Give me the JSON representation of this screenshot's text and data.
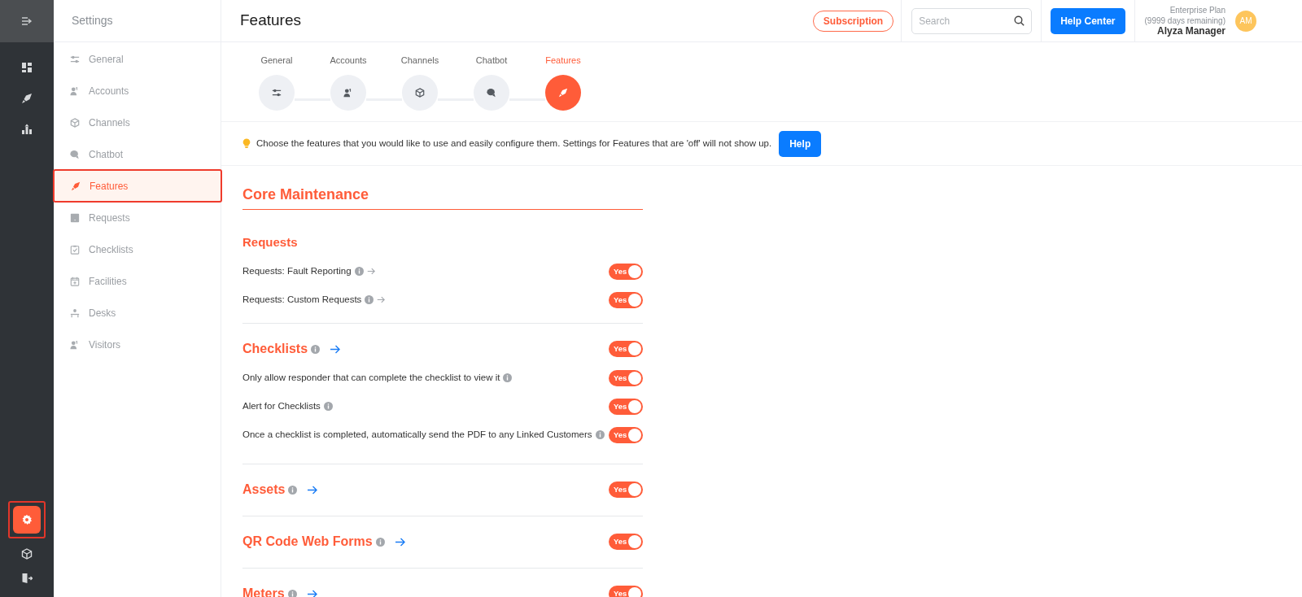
{
  "rail": {
    "top_items": [
      {
        "selected": false
      },
      {
        "selected": false
      },
      {
        "selected": false
      }
    ],
    "bottom_items": [
      {
        "selected": true
      },
      {
        "selected": false
      },
      {
        "selected": false
      }
    ]
  },
  "sidebar": {
    "title": "Settings",
    "items": [
      {
        "label": "General",
        "selected": false
      },
      {
        "label": "Accounts",
        "selected": false
      },
      {
        "label": "Channels",
        "selected": false
      },
      {
        "label": "Chatbot",
        "selected": false
      },
      {
        "label": "Features",
        "selected": true
      },
      {
        "label": "Requests",
        "selected": false
      },
      {
        "label": "Checklists",
        "selected": false
      },
      {
        "label": "Facilities",
        "selected": false
      },
      {
        "label": "Desks",
        "selected": false
      },
      {
        "label": "Visitors",
        "selected": false
      }
    ]
  },
  "header": {
    "title": "Features",
    "subscription": "Subscription",
    "search": {
      "placeholder": "Search"
    },
    "help_center": "Help Center",
    "plan": "Enterprise Plan",
    "days": "(9999 days remaining)",
    "user": "Alyza Manager",
    "avatar": "AM"
  },
  "stepper": {
    "steps": [
      {
        "label": "General",
        "selected": false
      },
      {
        "label": "Accounts",
        "selected": false
      },
      {
        "label": "Channels",
        "selected": false
      },
      {
        "label": "Chatbot",
        "selected": false
      },
      {
        "label": "Features",
        "selected": true
      }
    ]
  },
  "info_bar": {
    "text": "Choose the features that you would like to use and easily configure them. Settings for Features that are 'off' will not show up.",
    "button": "Help"
  },
  "section": {
    "title": "Core Maintenance"
  },
  "groups": [
    {
      "title": "Requests",
      "items": [
        {
          "label": "Requests: Fault Reporting",
          "info": true,
          "link": true,
          "on": true,
          "toggle_label": "Yes"
        },
        {
          "label": "Requests: Custom Requests",
          "info": true,
          "link": true,
          "on": true,
          "toggle_label": "Yes"
        }
      ]
    },
    {
      "title": "Checklists",
      "info": true,
      "link": true,
      "on": true,
      "toggle_label": "Yes",
      "items": [
        {
          "label": "Only allow responder that can complete the checklist to view it",
          "info": true,
          "link": false,
          "on": true,
          "toggle_label": "Yes"
        },
        {
          "label": "Alert for Checklists",
          "info": true,
          "link": false,
          "on": true,
          "toggle_label": "Yes"
        },
        {
          "label": "Once a checklist is completed, automatically send the PDF to any Linked Customers",
          "info": true,
          "link": false,
          "on": true,
          "toggle_label": "Yes"
        }
      ]
    },
    {
      "title": "Assets",
      "info": true,
      "link": true,
      "on": true,
      "toggle_label": "Yes"
    },
    {
      "title": "QR Code Web Forms",
      "info": true,
      "link": true,
      "on": true,
      "toggle_label": "Yes"
    },
    {
      "title": "Meters",
      "info": true,
      "link": true,
      "on": true,
      "toggle_label": "Yes"
    }
  ]
}
